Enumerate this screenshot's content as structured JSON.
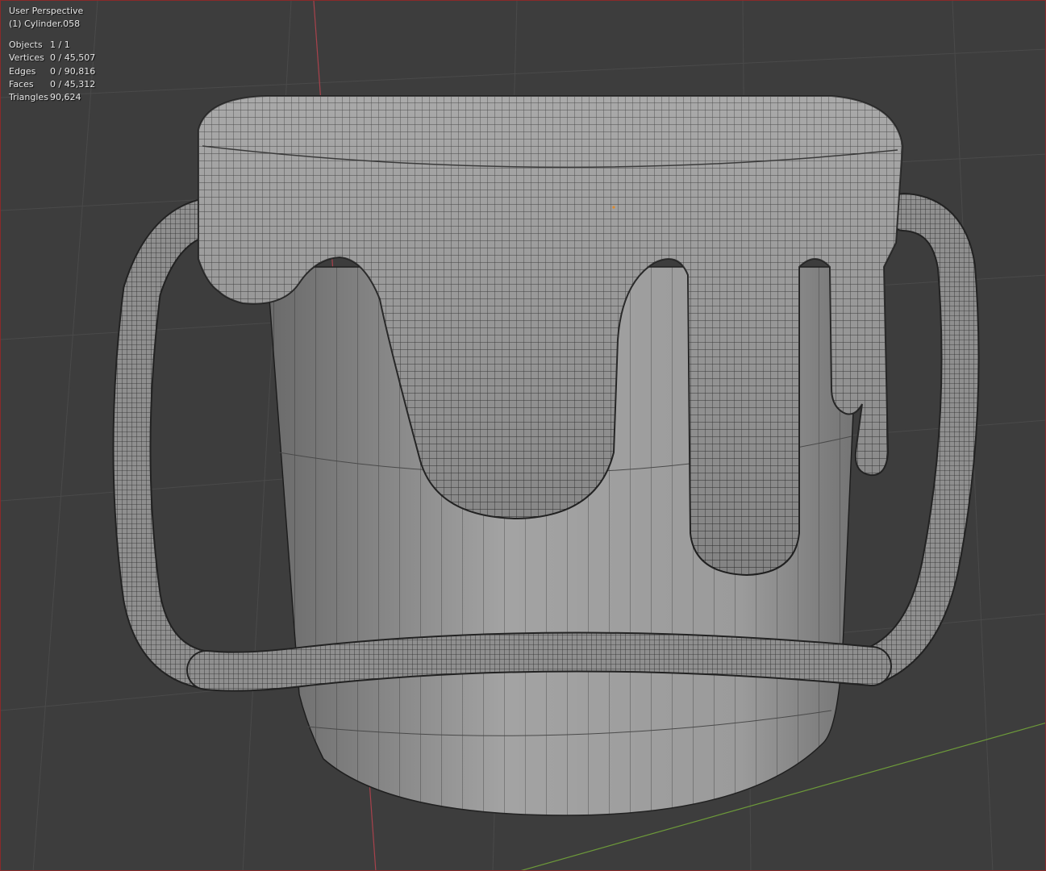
{
  "viewport": {
    "view_name": "User Perspective",
    "object_name": "(1) Cylinder.058",
    "background_color": "#3d3d3d",
    "grid_color": "#4a4a4a",
    "x_axis_color": "#6d9a3a",
    "y_axis_color": "#a8424c"
  },
  "stats": [
    {
      "label": "Objects",
      "value": "1 / 1"
    },
    {
      "label": "Vertices",
      "value": "0 / 45,507"
    },
    {
      "label": "Edges",
      "value": "0 / 90,816"
    },
    {
      "label": "Faces",
      "value": "0 / 45,312"
    },
    {
      "label": "Triangles",
      "value": "90,624"
    }
  ]
}
